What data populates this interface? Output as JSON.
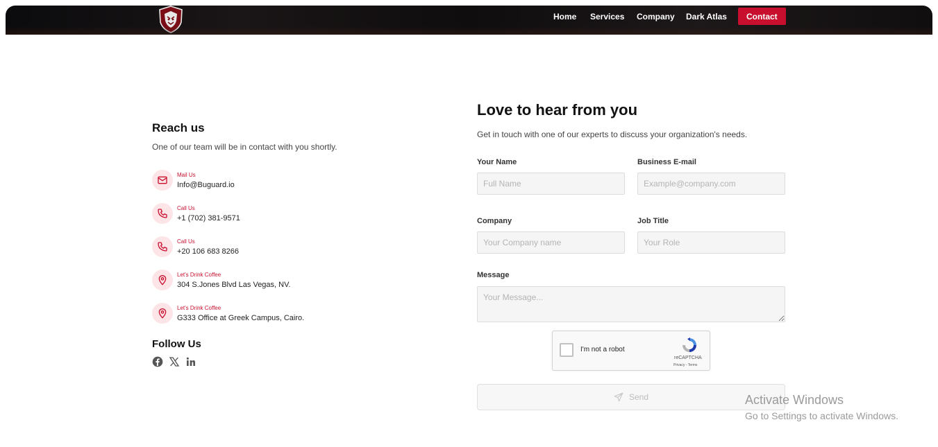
{
  "header": {
    "nav": [
      {
        "label": "Home"
      },
      {
        "label": "Services"
      },
      {
        "label": "Company"
      },
      {
        "label": "Dark Atlas"
      }
    ],
    "contact_label": "Contact",
    "accent_color": "#c8102e",
    "logo_icon": "shield-mask-logo-icon"
  },
  "reach": {
    "title": "Reach us",
    "subtitle": "One of our team will be in contact with you shortly.",
    "items": [
      {
        "icon": "mail-icon",
        "label": "Mail Us",
        "value": "Info@Buguard.io"
      },
      {
        "icon": "phone-icon",
        "label": "Call Us",
        "value": "+1 (702) 381-9571"
      },
      {
        "icon": "phone-icon",
        "label": "Call Us",
        "value": "+20 106 683 8266"
      },
      {
        "icon": "location-pin-icon",
        "label": "Let's Drink Coffee",
        "value": "304 S.Jones Blvd Las Vegas, NV."
      },
      {
        "icon": "location-pin-icon",
        "label": "Let's Drink Coffee",
        "value": "G333 Office at Greek Campus, Cairo."
      }
    ],
    "follow_title": "Follow Us",
    "social": [
      "facebook-icon",
      "x-icon",
      "linkedin-icon"
    ]
  },
  "form": {
    "title": "Love to hear from you",
    "subtitle": "Get in touch with one of our experts to discuss your organization's needs.",
    "name_label": "Your Name",
    "name_placeholder": "Full Name",
    "email_label": "Business E-mail",
    "email_placeholder": "Example@company.com",
    "company_label": "Company",
    "company_placeholder": "Your Company name",
    "job_label": "Job Title",
    "job_placeholder": "Your Role",
    "message_label": "Message",
    "message_placeholder": "Your Message...",
    "captcha_text": "I'm not a robot",
    "captcha_brand": "reCAPTCHA",
    "captcha_links": "Privacy - Terms",
    "send_label": "Send"
  },
  "watermark": {
    "title": "Activate Windows",
    "subtitle": "Go to Settings to activate Windows."
  }
}
